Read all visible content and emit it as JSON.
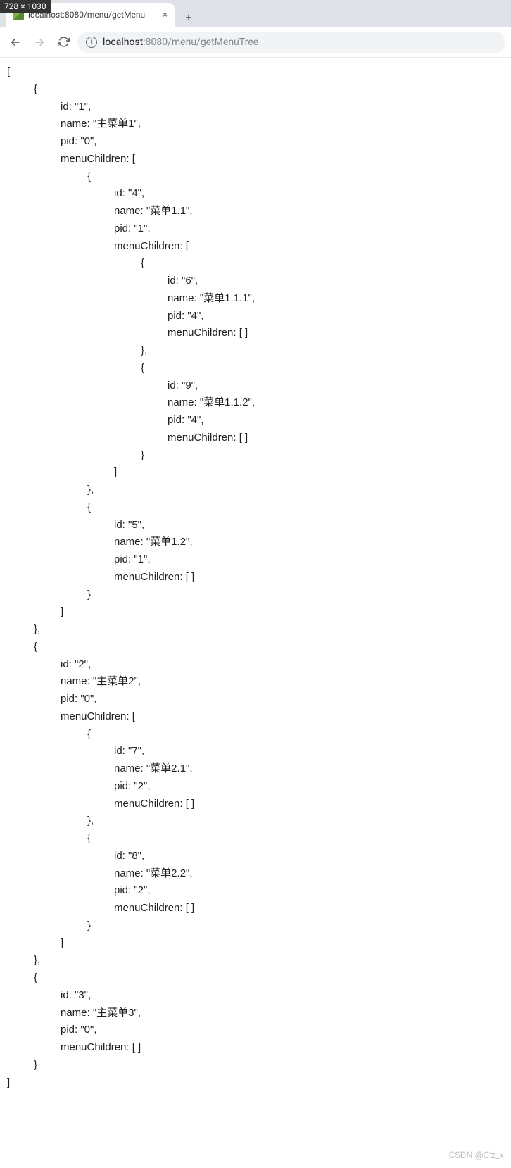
{
  "badge": "728 × 1030",
  "tab": {
    "title": "localhost:8080/menu/getMenu",
    "close": "×"
  },
  "newtab": "+",
  "url": {
    "host": "localhost",
    "port_path": ":8080/menu/getMenuTree"
  },
  "watermark": "CSDN @C'z_x",
  "json_tree": [
    {
      "id": "1",
      "name": "主菜单1",
      "pid": "0",
      "menuChildren": [
        {
          "id": "4",
          "name": "菜单1.1",
          "pid": "1",
          "menuChildren": [
            {
              "id": "6",
              "name": "菜单1.1.1",
              "pid": "4",
              "menuChildren": []
            },
            {
              "id": "9",
              "name": "菜单1.1.2",
              "pid": "4",
              "menuChildren": []
            }
          ]
        },
        {
          "id": "5",
          "name": "菜单1.2",
          "pid": "1",
          "menuChildren": []
        }
      ]
    },
    {
      "id": "2",
      "name": "主菜单2",
      "pid": "0",
      "menuChildren": [
        {
          "id": "7",
          "name": "菜单2.1",
          "pid": "2",
          "menuChildren": []
        },
        {
          "id": "8",
          "name": "菜单2.2",
          "pid": "2",
          "menuChildren": []
        }
      ]
    },
    {
      "id": "3",
      "name": "主菜单3",
      "pid": "0",
      "menuChildren": []
    }
  ]
}
